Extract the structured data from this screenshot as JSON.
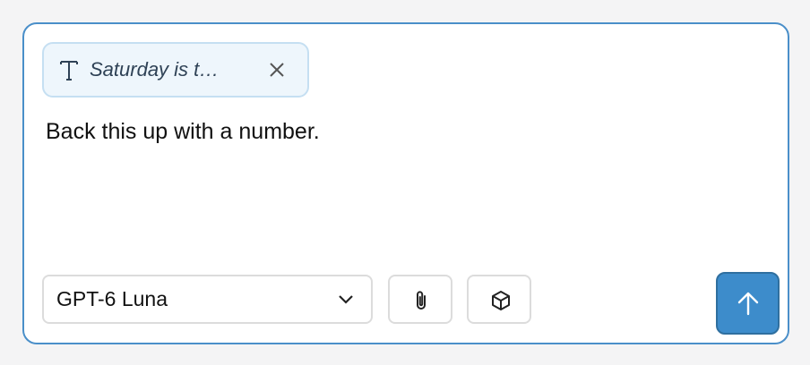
{
  "context_chip": {
    "text": "Saturday is t…",
    "type_icon": "text-type-icon",
    "close_icon": "close-icon"
  },
  "composer": {
    "message": "Back this up with a number."
  },
  "toolbar": {
    "model_selected": "GPT-6 Luna",
    "model_dropdown_icon": "chevron-down-icon",
    "attach_icon": "paperclip-icon",
    "box_icon": "cube-icon",
    "send_icon": "arrow-up-icon"
  },
  "colors": {
    "accent": "#3d8ccb",
    "border_focus": "#4a8fc9",
    "chip_bg": "#eef6fc"
  }
}
